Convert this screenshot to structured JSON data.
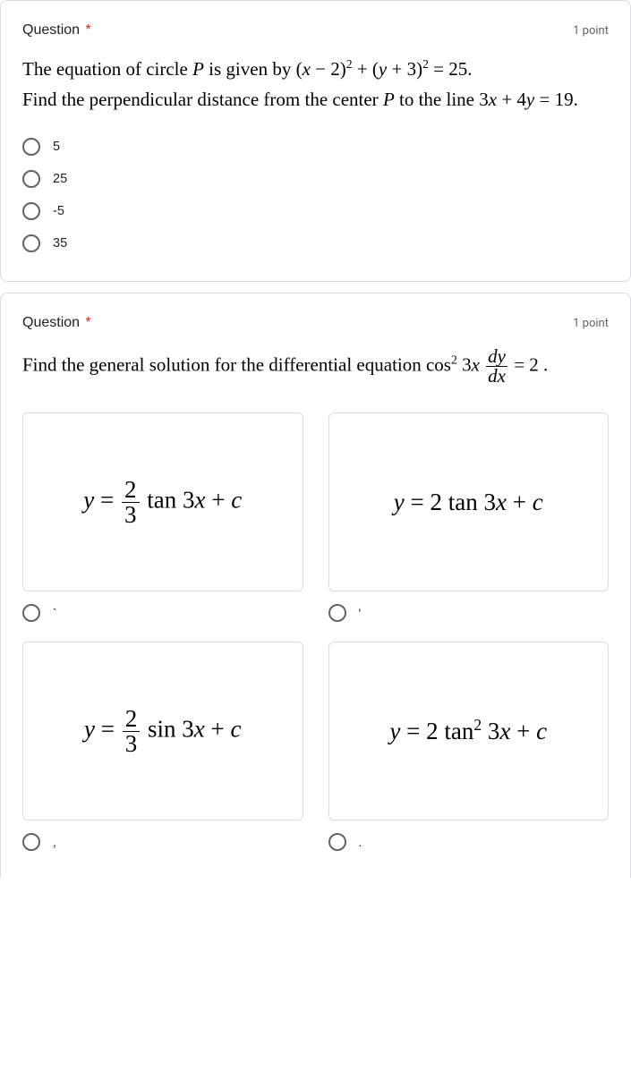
{
  "q1": {
    "title": "Question",
    "points": "1 point",
    "body_html": "The equation of circle <em>P</em> is given by (<em>x</em> − 2)<sup>2</sup> + (<em>y</em> + 3)<sup>2</sup> = 25.<br>Find the perpendicular distance from the center <em>P</em> to the line 3<em>x</em> + 4<em>y</em> = 19.",
    "options": [
      "5",
      "25",
      "-5",
      "35"
    ]
  },
  "q2": {
    "title": "Question",
    "points": "1 point",
    "body_prefix": "Find the general solution for the differential equation cos",
    "body_suffix": " = 2 .",
    "image_options": [
      {
        "label": "`",
        "eq_html": "<em>y</em> = <span class='frac'><span class='num'>2</span><span class='den'>3</span></span> tan 3<em>x</em> + <em>c</em>"
      },
      {
        "label": "'",
        "eq_html": "<em>y</em> = 2 tan 3<em>x</em> + <em>c</em>"
      },
      {
        "label": ",",
        "eq_html": "<em>y</em> = <span class='frac'><span class='num'>2</span><span class='den'>3</span></span> sin 3<em>x</em> + <em>c</em>"
      },
      {
        "label": ".",
        "eq_html": "<em>y</em> = 2 tan<sup>2</sup> 3<em>x</em> + <em>c</em>"
      }
    ]
  }
}
